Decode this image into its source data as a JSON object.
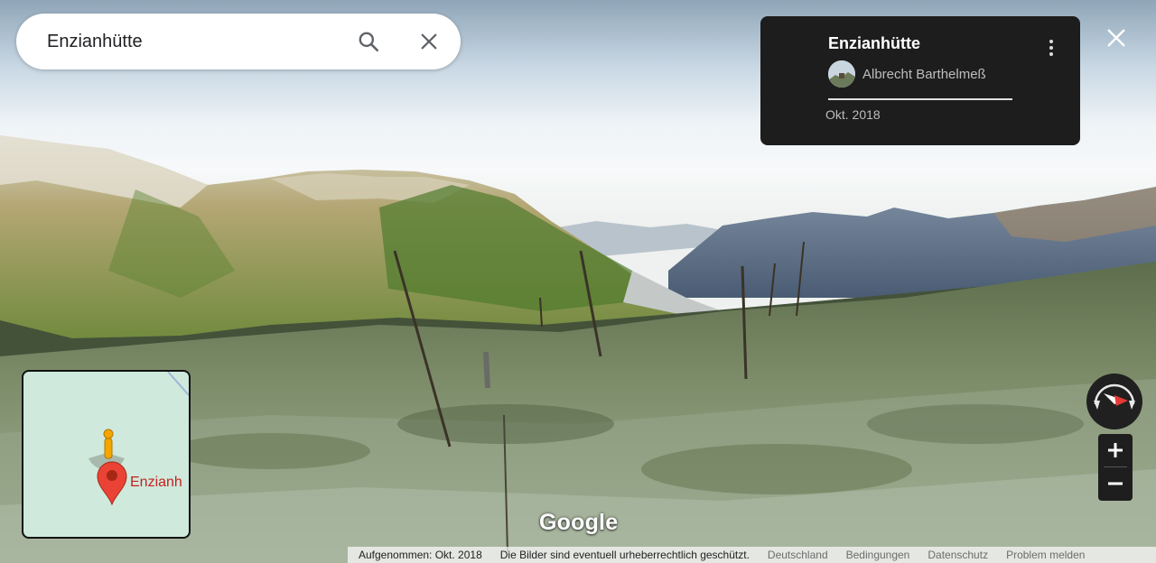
{
  "search": {
    "value": "Enzianhütte"
  },
  "info_card": {
    "title": "Enzianhütte",
    "author": "Albrecht Barthelmeß",
    "date": "Okt. 2018"
  },
  "minimap": {
    "place_label": "Enzianh"
  },
  "logo": {
    "text": "Google"
  },
  "footer": {
    "captured": "Aufgenommen: Okt. 2018",
    "copyright": "Die Bilder sind eventuell urheberrechtlich geschützt.",
    "links": [
      "Deutschland",
      "Bedingungen",
      "Datenschutz",
      "Problem melden"
    ]
  },
  "icons": {
    "search": "search-icon",
    "clear": "close-icon",
    "more": "more-vert-icon",
    "exit": "close-icon",
    "compass": "compass-icon",
    "zoom_in": "plus-icon",
    "zoom_out": "minus-icon"
  },
  "colors": {
    "card_bg": "#1d1d1d",
    "map_bg": "#cfe9dc",
    "pin": "#ea4335",
    "pegman": "#f2a600"
  }
}
